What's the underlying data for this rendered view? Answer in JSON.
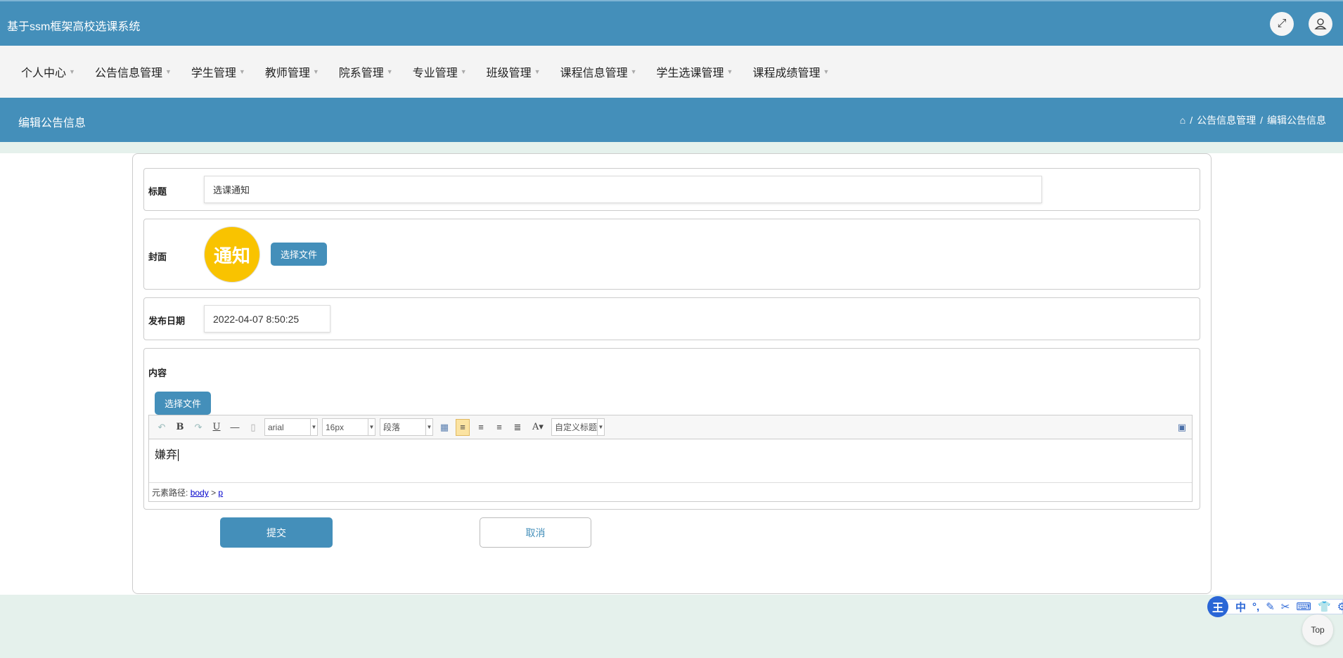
{
  "header": {
    "title": "基于ssm框架高校选课系统"
  },
  "nav": [
    "个人中心",
    "公告信息管理",
    "学生管理",
    "教师管理",
    "院系管理",
    "专业管理",
    "班级管理",
    "课程信息管理",
    "学生选课管理",
    "课程成绩管理"
  ],
  "titlebar": {
    "title": "编辑公告信息",
    "breadcrumb": [
      "公告信息管理",
      "编辑公告信息"
    ],
    "sep": "/"
  },
  "form": {
    "title_label": "标题",
    "title_value": "选课通知",
    "cover_label": "封面",
    "cover_image_text": "通知",
    "choose_file": "选择文件",
    "date_label": "发布日期",
    "date_value": "2022-04-07 8:50:25",
    "content_label": "内容",
    "content_choose_file": "选择文件",
    "editor": {
      "font": "arial",
      "size": "16px",
      "paragraph": "段落",
      "custom_heading": "自定义标题",
      "content": "嫌弃",
      "path_label": "元素路径:",
      "path_body": "body",
      "path_gt": ">",
      "path_p": "p"
    },
    "submit": "提交",
    "cancel": "取消"
  },
  "ime": {
    "items": [
      "中",
      "°,"
    ]
  },
  "top_button": "Top"
}
